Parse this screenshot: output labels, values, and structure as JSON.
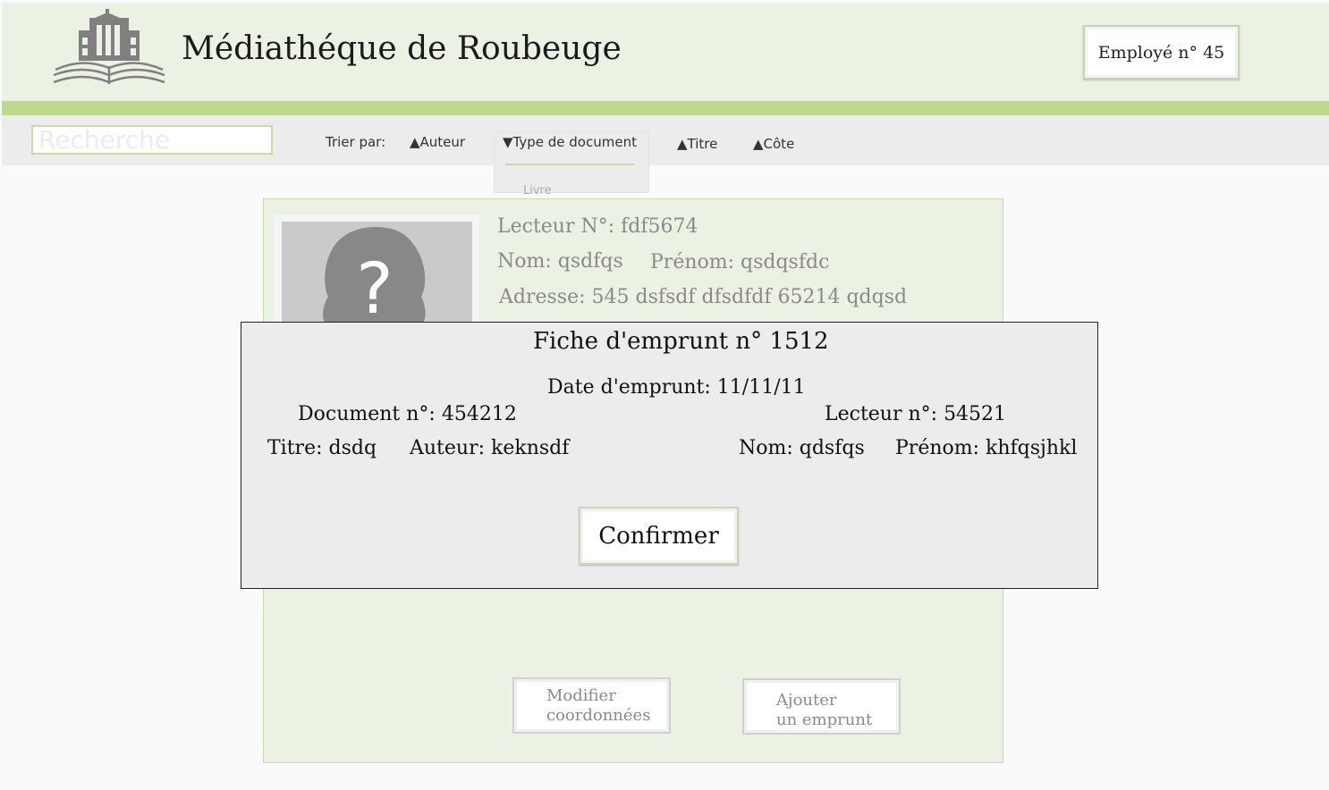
{
  "header": {
    "title": "Médiathéque de Roubeuge",
    "employee_label": "Employé n° 45"
  },
  "toolbar": {
    "search_placeholder": "Recherche",
    "sort_label": "Trier par:",
    "sort_options": [
      {
        "label": "▲Auteur"
      },
      {
        "label": "▼Type de document"
      },
      {
        "label": "▲Titre"
      },
      {
        "label": "▲Côte"
      }
    ],
    "type_dropdown_first": "Livre"
  },
  "reader": {
    "photo_placeholder": "?",
    "number": "Lecteur N°: fdf5674",
    "nom": "Nom: qsdfqs",
    "prenom": "Prénom: qsdqsfdc",
    "adresse": "Adresse: 545 dsfsdf dfsdfdf 65214 qdqsd",
    "modify_label_1": "Modifier",
    "modify_label_2": "coordonnées",
    "add_loan_label_1": "Ajouter",
    "add_loan_label_2": "un emprunt"
  },
  "modal": {
    "title": "Fiche d'emprunt n° 1512",
    "date": "Date d'emprunt: 11/11/11",
    "document_no": "Document n°: 454212",
    "titre": "Titre: dsdq",
    "auteur": "Auteur: keknsdf",
    "lecteur_no": "Lecteur n°: 54521",
    "nom": "Nom: qdsfqs",
    "prenom": "Prénom: khfqsjhkl",
    "confirm_label": "Confirmer"
  },
  "colors": {
    "header_bg": "#ebf1e3",
    "accent_green": "#bed98c",
    "toolbar_bg": "#ececec",
    "modal_bg": "#ececec"
  }
}
